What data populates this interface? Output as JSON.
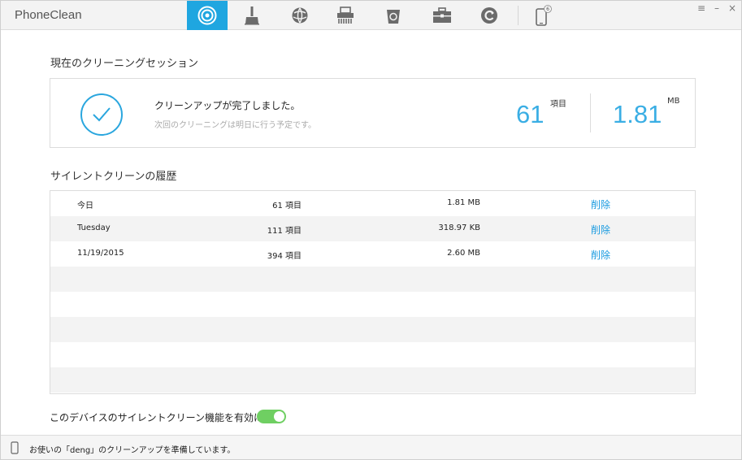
{
  "app": {
    "title": "PhoneClean"
  },
  "toolbar": {
    "tools": [
      {
        "name": "silent-clean",
        "icon": "silent-clean-icon",
        "active": true
      },
      {
        "name": "quick-clean",
        "icon": "broom-icon"
      },
      {
        "name": "internet-clean",
        "icon": "globe-icon"
      },
      {
        "name": "privacy-clean",
        "icon": "shredder-icon"
      },
      {
        "name": "trash",
        "icon": "trash-icon"
      },
      {
        "name": "toolbox",
        "icon": "toolbox-icon"
      },
      {
        "name": "restore",
        "icon": "restore-icon"
      },
      {
        "name": "device",
        "icon": "phone-icon",
        "badge": "6"
      }
    ],
    "window_controls": [
      "≡",
      "–",
      "×"
    ]
  },
  "session": {
    "heading": "現在のクリーニングセッション",
    "status": "クリーンアップが完了しました。",
    "next": "次回のクリーニングは明日に行う予定です。",
    "item_count": "61",
    "item_unit": "項目",
    "size_value": "1.81",
    "size_unit": "MB"
  },
  "history": {
    "heading": "サイレントクリーンの履歴",
    "rows": [
      {
        "date": "今日",
        "items": "61 項目",
        "size": "1.81 MB",
        "action": "削除"
      },
      {
        "date": "Tuesday",
        "items": "111 項目",
        "size": "318.97 KB",
        "action": "削除"
      },
      {
        "date": "11/19/2015",
        "items": "394 項目",
        "size": "2.60 MB",
        "action": "削除"
      }
    ]
  },
  "silent_toggle": {
    "label": "このデバイスのサイレントクリーン機能を有効にする",
    "enabled": true
  },
  "status_bar": {
    "text": "お使いの「deng」のクリーンアップを準備しています。"
  },
  "colors": {
    "accent": "#1fa6e0",
    "link": "#1a9be0",
    "toggle_on": "#6fcf62"
  }
}
